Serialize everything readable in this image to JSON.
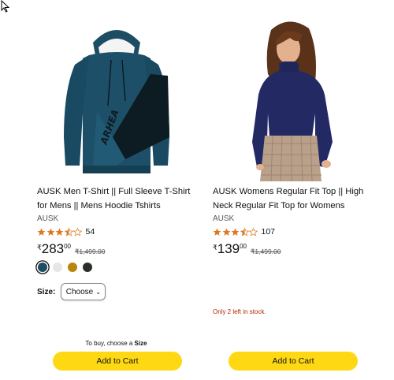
{
  "products": [
    {
      "title": "AUSK Men T-Shirt || Full Sleeve T-Shirt for Mens || Mens Hoodie Tshirts",
      "brand": "AUSK",
      "rating_count": "54",
      "rating_value": 3.5,
      "price": {
        "currency": "₹",
        "whole": "283",
        "fraction": "00",
        "mrp": "₹1,499.00"
      },
      "swatches": [
        {
          "name": "teal",
          "color": "#1d4d63",
          "selected": true
        },
        {
          "name": "white",
          "color": "#e6e6e6",
          "selected": false
        },
        {
          "name": "mustard",
          "color": "#b8860b",
          "selected": false
        },
        {
          "name": "dark-olive",
          "color": "#2b2f2a",
          "selected": false
        }
      ],
      "size_label": "Size:",
      "size_select": "Choose",
      "choose_note_prefix": "To buy, choose a",
      "choose_note_bold": "Size",
      "add_to_cart": "Add to Cart"
    },
    {
      "title": "AUSK Womens Regular Fit Top || High Neck Regular Fit Top for Womens",
      "brand": "AUSK",
      "rating_count": "107",
      "rating_value": 3.5,
      "price": {
        "currency": "₹",
        "whole": "139",
        "fraction": "00",
        "mrp": "₹1,499.00"
      },
      "stock_note": "Only 2 left in stock.",
      "add_to_cart": "Add to Cart"
    }
  ],
  "colors": {
    "star": "#de7921",
    "button": "#ffd814",
    "stock": "#b12704"
  }
}
